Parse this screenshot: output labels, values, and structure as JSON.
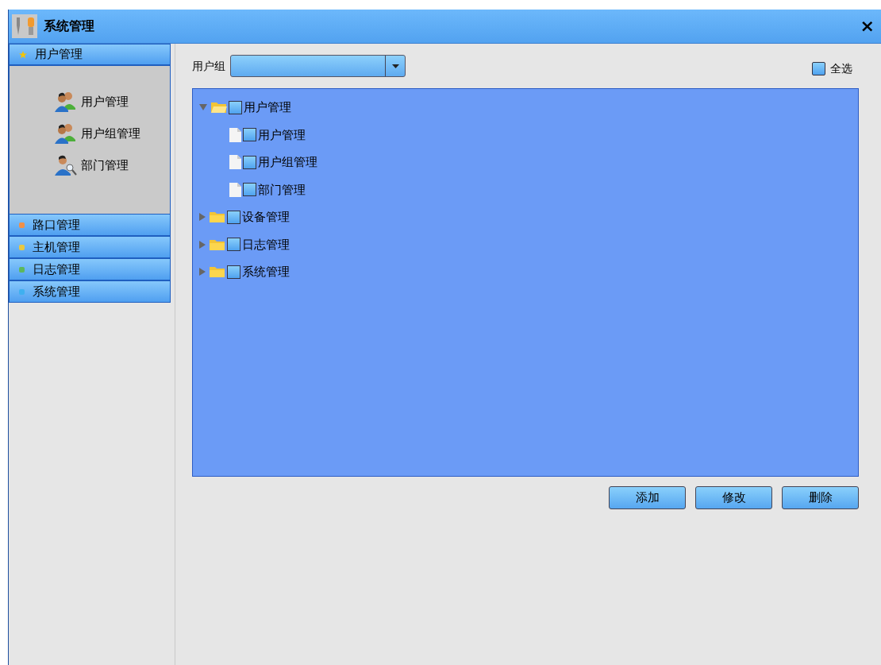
{
  "window": {
    "title": "系统管理",
    "close": "×"
  },
  "sidebar": {
    "sections": [
      {
        "label": "用户管理",
        "kind": "star",
        "color": "#f5c400",
        "expanded": true,
        "items": [
          {
            "label": "用户管理",
            "kind": "users"
          },
          {
            "label": "用户组管理",
            "kind": "users"
          },
          {
            "label": "部门管理",
            "kind": "dept"
          }
        ]
      },
      {
        "label": "路口管理",
        "kind": "dot",
        "color": "#f0904a",
        "expanded": false
      },
      {
        "label": "主机管理",
        "kind": "dot",
        "color": "#e8c840",
        "expanded": false
      },
      {
        "label": "日志管理",
        "kind": "dot",
        "color": "#5cb85c",
        "expanded": false
      },
      {
        "label": "系统管理",
        "kind": "dot",
        "color": "#3fb0f0",
        "expanded": false
      }
    ]
  },
  "filter": {
    "label": "用户组"
  },
  "select_all": {
    "label": "全选",
    "checked": false
  },
  "tree": [
    {
      "label": "用户管理",
      "kind": "folder",
      "expanded": true,
      "checked": false,
      "children": [
        {
          "label": "用户管理",
          "kind": "file",
          "checked": false
        },
        {
          "label": "用户组管理",
          "kind": "file",
          "checked": false
        },
        {
          "label": "部门管理",
          "kind": "file",
          "checked": false
        }
      ]
    },
    {
      "label": "设备管理",
      "kind": "folder",
      "expanded": false,
      "checked": false
    },
    {
      "label": "日志管理",
      "kind": "folder",
      "expanded": false,
      "checked": false
    },
    {
      "label": "系统管理",
      "kind": "folder",
      "expanded": false,
      "checked": false
    }
  ],
  "buttons": [
    "添加",
    "修改",
    "删除"
  ]
}
